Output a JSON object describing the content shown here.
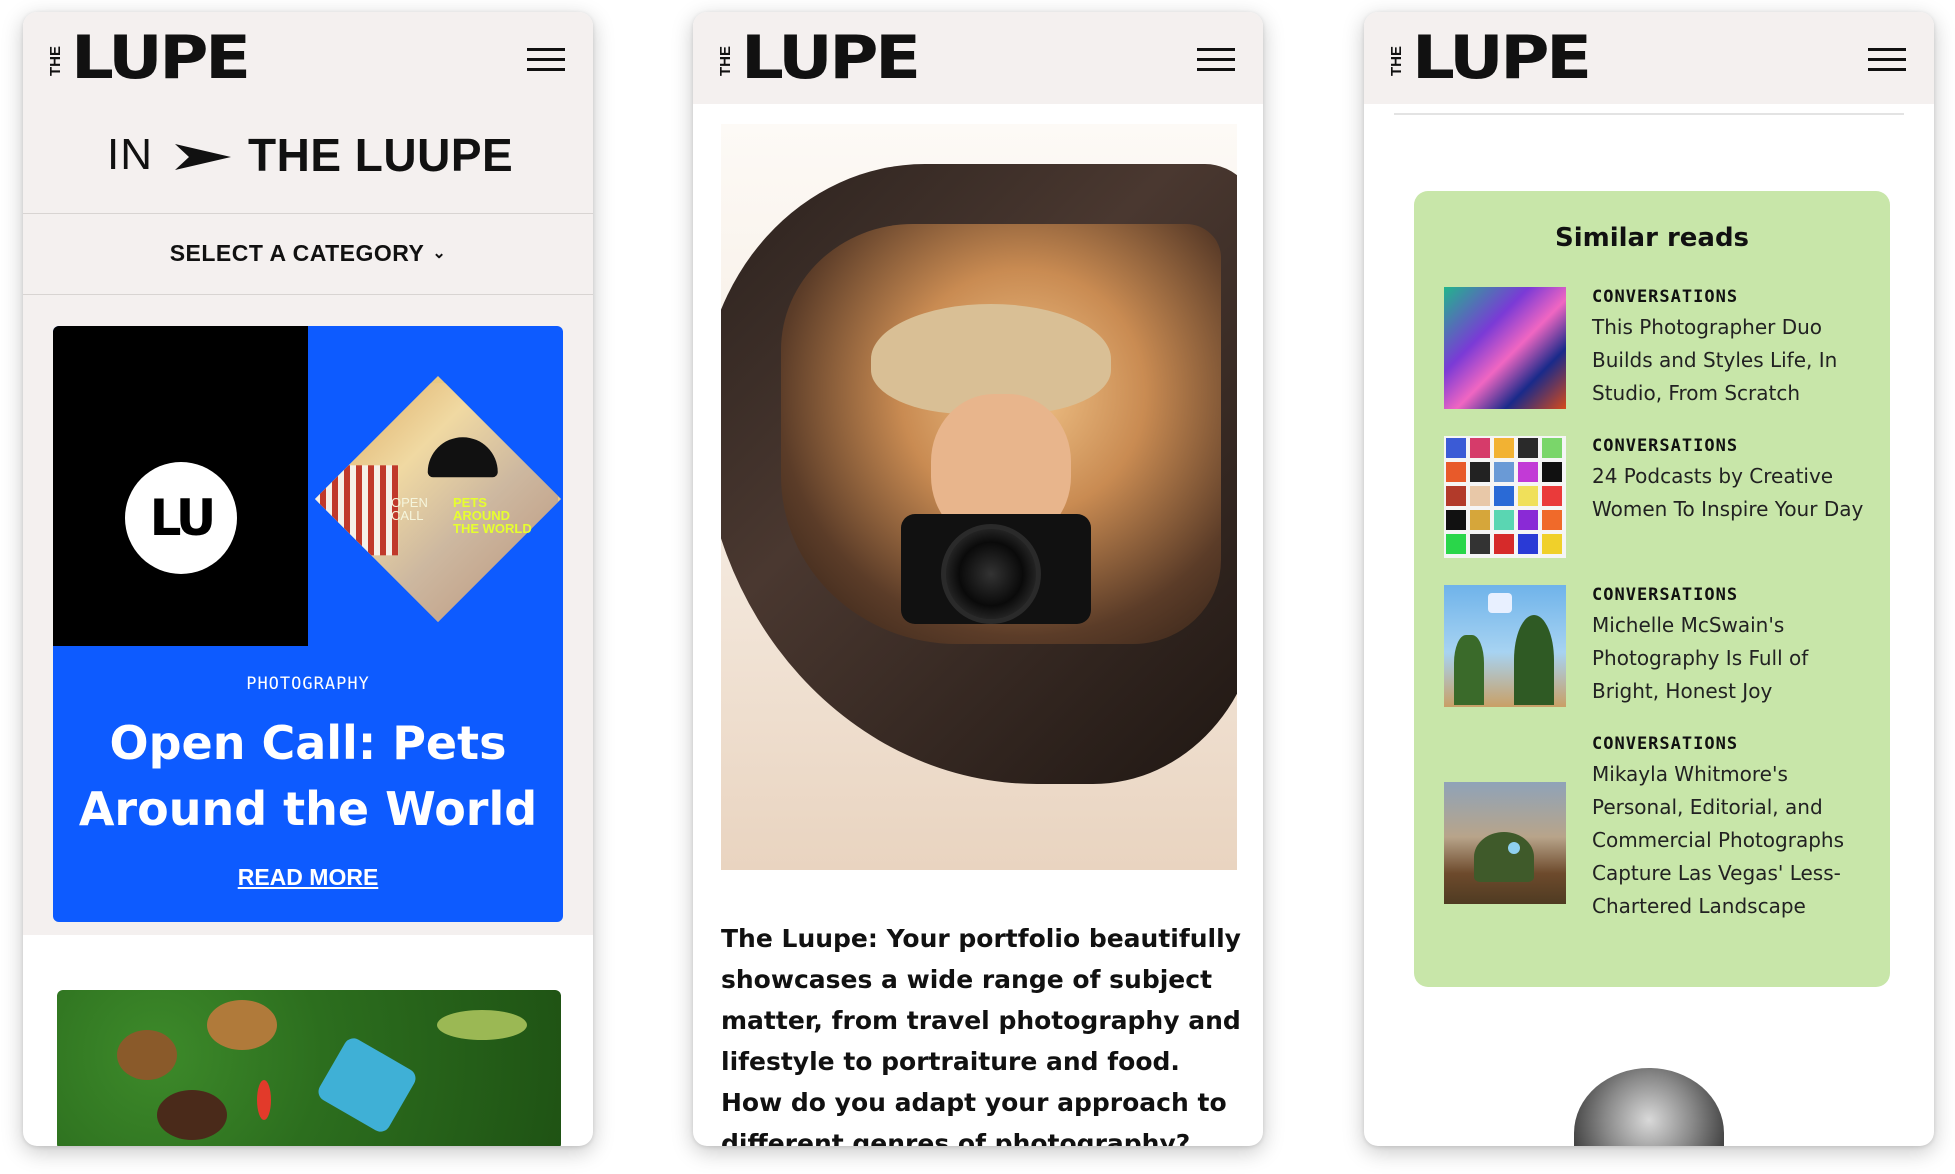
{
  "brand": {
    "logo_the": "THE",
    "logo_word": "LUPE"
  },
  "phone1": {
    "in_word": "IN",
    "in_luupe": "THE LUUPE",
    "category_label": "SELECT A CATEGORY",
    "chevron_icon": "chevron-down-icon",
    "card": {
      "badge": "LU",
      "diamond_left": "OPEN CALL",
      "diamond_right": "PETS AROUND THE WORLD",
      "category": "PHOTOGRAPHY",
      "title": "Open Call: Pets Around the World",
      "link": "READ MORE",
      "color": "#0d5bff"
    }
  },
  "phone2": {
    "text": "The Luupe: Your portfolio beautifully showcases a wide range of subject matter, from travel photography and lifestyle to portraiture and food. How do you adapt your approach to different genres of photography?"
  },
  "phone3": {
    "heading": "Similar reads",
    "bg_color": "#c8e6a9",
    "items": [
      {
        "category": "CONVERSATIONS",
        "title": "This Photographer Duo Builds and Styles Life, In Studio, From Scratch"
      },
      {
        "category": "CONVERSATIONS",
        "title": "24 Podcasts by Creative Women To Inspire Your Day"
      },
      {
        "category": "CONVERSATIONS",
        "title": "Michelle McSwain's Photography Is Full of Bright, Honest Joy"
      },
      {
        "category": "CONVERSATIONS",
        "title": "Mikayla Whitmore's Personal, Editorial, and Commercial Photographs Capture Las Vegas' Less-Chartered Landscape"
      }
    ]
  },
  "icons": {
    "menu": "hamburger-menu-icon"
  }
}
